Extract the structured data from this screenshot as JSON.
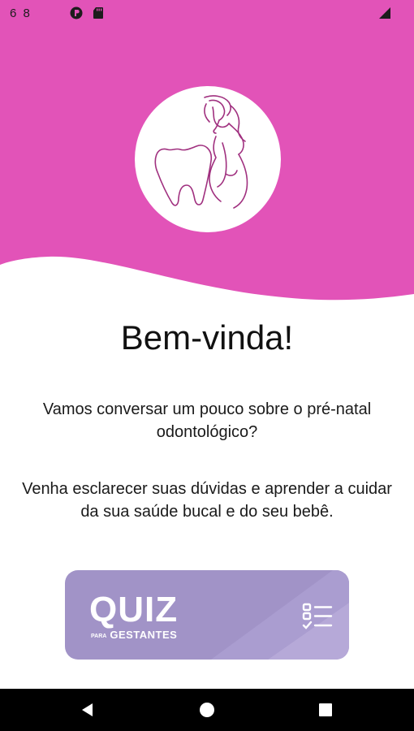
{
  "status_bar": {
    "time": "6 8",
    "icons": [
      "app-notification-icon",
      "sd-card-icon",
      "signal-icon"
    ]
  },
  "colors": {
    "header_pink": "#e253b8",
    "quiz_purple": "#a193c7",
    "logo_line": "#a0307f"
  },
  "welcome": {
    "title": "Bem-vinda!",
    "intro": "Vamos conversar um pouco sobre o pré-natal odontológico?",
    "help": "Venha esclarecer suas dúvidas e aprender a cuidar da sua saúde bucal e do seu bebê."
  },
  "quiz_button": {
    "title": "QUIZ",
    "subtitle_small": "PARA",
    "subtitle": "GESTANTES",
    "icon": "checklist-icon"
  },
  "nav_bar": {
    "icons": [
      "back-icon",
      "home-icon",
      "recents-icon"
    ]
  }
}
